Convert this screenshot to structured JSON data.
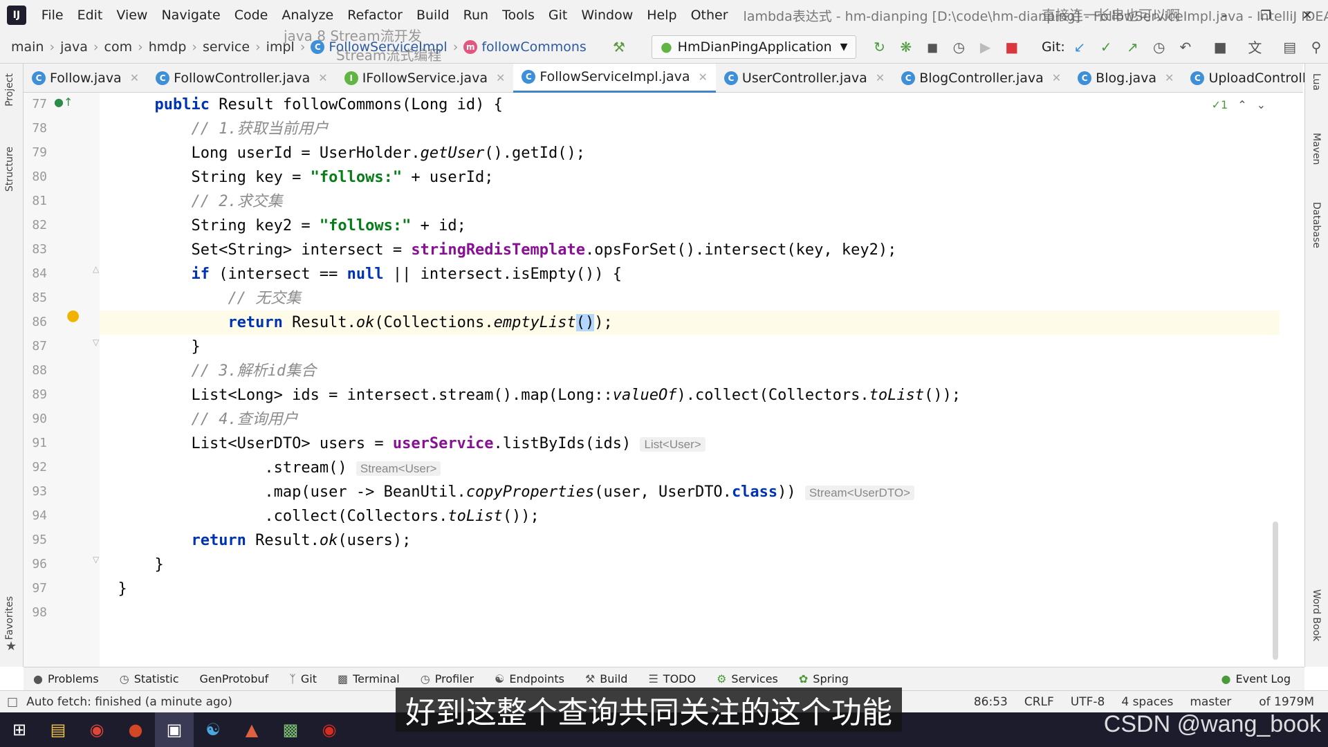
{
  "window": {
    "title": "lambda表达式 - hm-dianping [D:\\code\\hm-dianping] - FollowServiceImpl.java - IntelliJ IDEA",
    "menu": [
      "File",
      "Edit",
      "View",
      "Navigate",
      "Code",
      "Analyze",
      "Refactor",
      "Build",
      "Run",
      "Tools",
      "Git",
      "Window",
      "Help",
      "Other"
    ],
    "controls": [
      "minimize",
      "restore",
      "close"
    ]
  },
  "breadcrumb": [
    "main",
    "java",
    "com",
    "hmdp",
    "service",
    "impl",
    "FollowServiceImpl",
    "followCommons"
  ],
  "toolbar": {
    "run_config": "HmDianPingApplication",
    "git_label": "Git:"
  },
  "tabs": [
    {
      "label": "Follow.java",
      "icon": "C",
      "active": false
    },
    {
      "label": "FollowController.java",
      "icon": "C",
      "active": false
    },
    {
      "label": "IFollowService.java",
      "icon": "I",
      "active": false
    },
    {
      "label": "FollowServiceImpl.java",
      "icon": "C",
      "active": true
    },
    {
      "label": "UserController.java",
      "icon": "C",
      "active": false
    },
    {
      "label": "BlogController.java",
      "icon": "C",
      "active": false
    },
    {
      "label": "Blog.java",
      "icon": "C",
      "active": false
    },
    {
      "label": "UploadController.java",
      "icon": "C",
      "active": false
    }
  ],
  "left_tool_windows": [
    "Project",
    "Structure",
    "Favorites"
  ],
  "right_tool_windows": [
    "Lua",
    "Maven",
    "Database",
    "Word Book"
  ],
  "editor": {
    "warnings_count": "1",
    "line_numbers": [
      "77",
      "78",
      "79",
      "80",
      "81",
      "82",
      "83",
      "84",
      "85",
      "86",
      "87",
      "88",
      "89",
      "90",
      "91",
      "92",
      "93",
      "94",
      "95",
      "96",
      "97",
      "98"
    ],
    "hints": [
      "List<User>",
      "Stream<User>",
      "Stream<UserDTO>"
    ],
    "comments": [
      "// 1.获取当前用户",
      "// 2.求交集",
      "// 无交集",
      "// 3.解析id集合",
      "// 4.查询用户"
    ],
    "strings": [
      "\"follows:\"",
      "\"follows:\""
    ]
  },
  "bottom_tools": [
    "Problems",
    "Statistic",
    "GenProtobuf",
    "Git",
    "Terminal",
    "Profiler",
    "Endpoints",
    "Build",
    "TODO",
    "Services",
    "Spring",
    "Event Log"
  ],
  "status": {
    "message": "Auto fetch: finished (a minute ago)",
    "position": "86:53",
    "line_sep": "CRLF",
    "encoding": "UTF-8",
    "indent": "4 spaces",
    "branch": "master",
    "memory": "of 1979M"
  },
  "overlay": {
    "subtitle": "好到这整个查询共同关注的这个功能",
    "watermark": "CSDN @wang_book",
    "top_captions": [
      "java 8 Stream流开发",
      "Stream流式编程",
      "直接连一长串也可以啊"
    ]
  },
  "taskbar_apps": [
    "start",
    "file-explorer",
    "chrome",
    "powerpoint",
    "intellij",
    "browser",
    "app",
    "terminal",
    "redis"
  ]
}
